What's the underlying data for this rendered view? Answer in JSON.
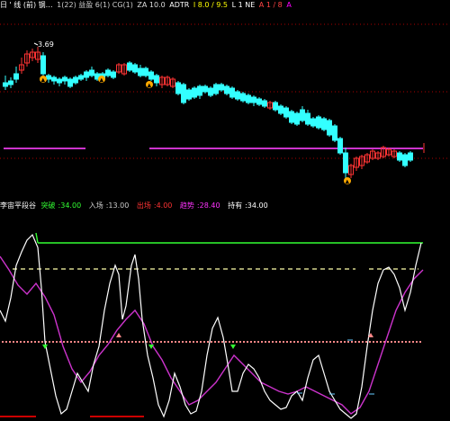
{
  "main_header": {
    "title": "日 ' 线 (前) 钢…",
    "items": [
      {
        "text": "1(22) 益盈 6(1) CG(1)",
        "color": "#cccccc"
      },
      {
        "text": "ZA 10.0",
        "color": "#dddddd"
      },
      {
        "text": "ADTR",
        "color": "#ffffff"
      },
      {
        "text": "I 8.0 / 9.5",
        "color": "#ffff00"
      },
      {
        "text": "L 1 NE",
        "color": "#ffffff"
      },
      {
        "text": "A 1 / 8",
        "color": "#ff4040"
      },
      {
        "text": "A",
        "color": "#ff00ff"
      }
    ]
  },
  "price_label": "3.69",
  "indicator_header": {
    "name": "李宙平段谷",
    "items": [
      {
        "label": "突破",
        "value": "34.00",
        "color": "#33ff33"
      },
      {
        "label": "入场",
        "value": "13.00",
        "color": "#cccccc"
      },
      {
        "label": "出场",
        "value": "4.00",
        "color": "#ff3333"
      },
      {
        "label": "趋势",
        "value": "28.40",
        "color": "#ff33ff"
      },
      {
        "label": "持有",
        "value": "34.00",
        "color": "#ffffff"
      }
    ]
  },
  "colors": {
    "up": "#ff3333",
    "down": "#33ffff",
    "purple": "#cc33cc",
    "green": "#33ff33",
    "white": "#ffffff",
    "yellow_dash": "#ffffaa",
    "pink": "#ff8888",
    "marker": "#ffaa00"
  }
}
